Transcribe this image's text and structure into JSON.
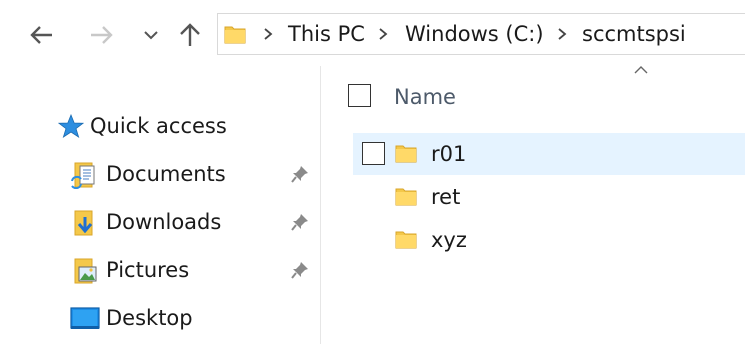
{
  "toolbar": {
    "back_icon": "arrow-left-icon",
    "forward_icon": "arrow-right-icon",
    "recent_icon": "chevron-down-icon",
    "up_icon": "arrow-up-icon"
  },
  "address": {
    "crumbs": [
      "This PC",
      "Windows (C:)",
      "sccmtspsi"
    ]
  },
  "navigation": {
    "quick_access": "Quick access",
    "items": [
      {
        "label": "Documents",
        "icon": "documents-icon",
        "pinned": true
      },
      {
        "label": "Downloads",
        "icon": "downloads-icon",
        "pinned": true
      },
      {
        "label": "Pictures",
        "icon": "pictures-icon",
        "pinned": true
      },
      {
        "label": "Desktop",
        "icon": "desktop-icon",
        "pinned": false
      }
    ]
  },
  "content": {
    "column_header": "Name",
    "files": [
      {
        "name": "r01",
        "selected": true
      },
      {
        "name": "ret",
        "selected": false
      },
      {
        "name": "xyz",
        "selected": false
      }
    ]
  },
  "colors": {
    "selection": "#e5f3ff",
    "folder": "#f4c84a",
    "quick_access_star": "#2d8ee0"
  }
}
